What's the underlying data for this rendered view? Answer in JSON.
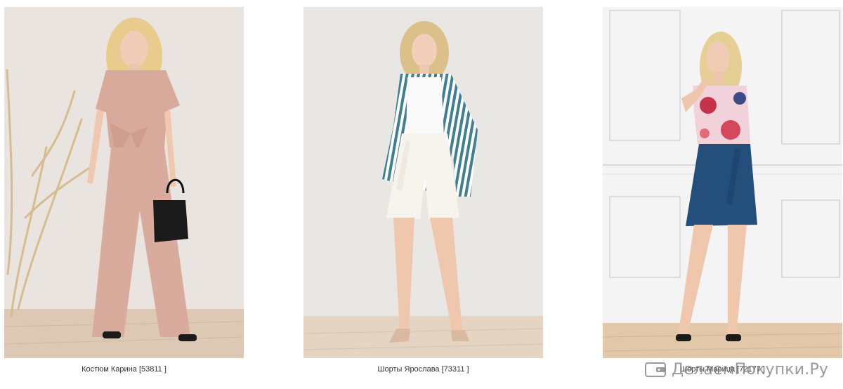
{
  "products": [
    {
      "caption": "Костюм Карина [53811 ]",
      "bg": "#e9e6e2",
      "floor": "#dcc8b4"
    },
    {
      "caption": "Шорты Ярослава [73311 ]",
      "bg": "#e8e6e3",
      "floor": "#e5d4c2"
    },
    {
      "caption": "Шорты Марица [72177 ]",
      "bg": "#f4f3f4",
      "floor": "#e2c7a8"
    }
  ],
  "watermark": {
    "text": "ДелаемПокупки.Ру",
    "icon": "wallet-icon"
  }
}
